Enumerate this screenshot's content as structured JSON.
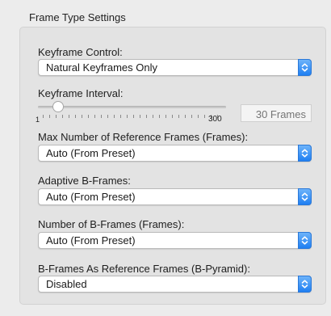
{
  "group": {
    "title": "Frame Type Settings"
  },
  "keyframe_control": {
    "label": "Keyframe Control:",
    "value": "Natural Keyframes Only"
  },
  "keyframe_interval": {
    "label": "Keyframe Interval:",
    "slider_min": "1",
    "slider_max": "300",
    "slider_value": 30,
    "field_value": "",
    "field_placeholder": "30 Frames"
  },
  "max_reference_frames": {
    "label": "Max Number of Reference Frames (Frames):",
    "value": "Auto (From Preset)"
  },
  "adaptive_b_frames": {
    "label": "Adaptive B-Frames:",
    "value": "Auto (From Preset)"
  },
  "number_of_b_frames": {
    "label": "Number of B-Frames (Frames):",
    "value": "Auto (From Preset)"
  },
  "b_pyramid": {
    "label": "B-Frames As Reference Frames (B-Pyramid):",
    "value": "Disabled"
  },
  "colors": {
    "accent": "#1f7ff2",
    "background": "#ececec",
    "group_background": "#e3e3e3"
  },
  "icons": {
    "popup_arrows": "updown-chevron-icon",
    "slider_knob": "slider-knob-icon"
  }
}
